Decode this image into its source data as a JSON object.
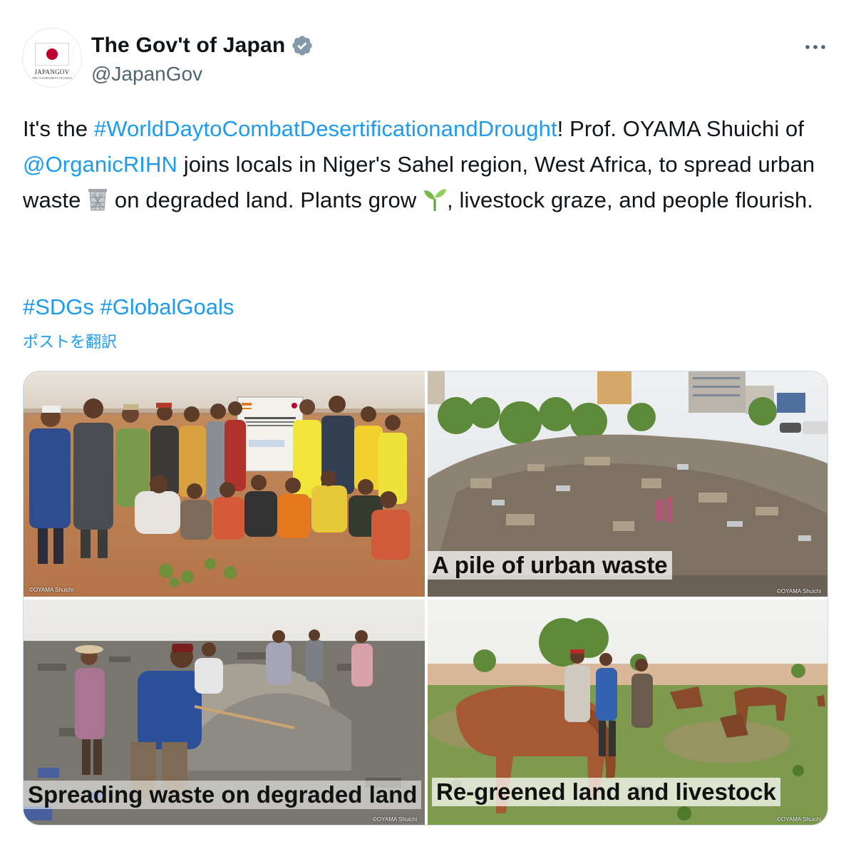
{
  "author": {
    "display_name": "The Gov't of Japan",
    "handle": "@JapanGov",
    "avatar_logo": "JAPANGOV",
    "avatar_sub": "THE GOVERNMENT OF JAPAN",
    "verified_icon": "verified-badge-icon"
  },
  "tweet": {
    "seg1": "It's the ",
    "hashtag_day": "#WorldDaytoCombatDesertificationandDrought",
    "seg2": "! Prof. OYAMA Shuichi of ",
    "mention": "@OrganicRIHN",
    "seg3": " joins locals in Niger's Sahel region, West Africa, to spread urban waste ",
    "trash_icon": "wastebasket-icon",
    "seg4": " on degraded land. Plants grow ",
    "sprout_icon": "seedling-icon",
    "seg5": ", livestock graze, and people flourish.",
    "tag_sdgs": "#SDGs",
    "tag_global": "#GlobalGoals",
    "translate_label": "ポストを翻訳"
  },
  "media": {
    "images": [
      {
        "caption": "",
        "credit": "©OYAMA Shuichi"
      },
      {
        "caption": "A pile of urban waste",
        "credit": "©OYAMA Shuichi"
      },
      {
        "caption": "Spreading waste on degraded land",
        "credit": "©OYAMA Shuichi"
      },
      {
        "caption": "Re-greened land and livestock",
        "credit": "©OYAMA Shuichi"
      }
    ]
  },
  "colors": {
    "link": "#1d9bf0",
    "text": "#0f1419",
    "secondary": "#536471",
    "border": "#cfd9de",
    "japan_red": "#bc002d"
  }
}
